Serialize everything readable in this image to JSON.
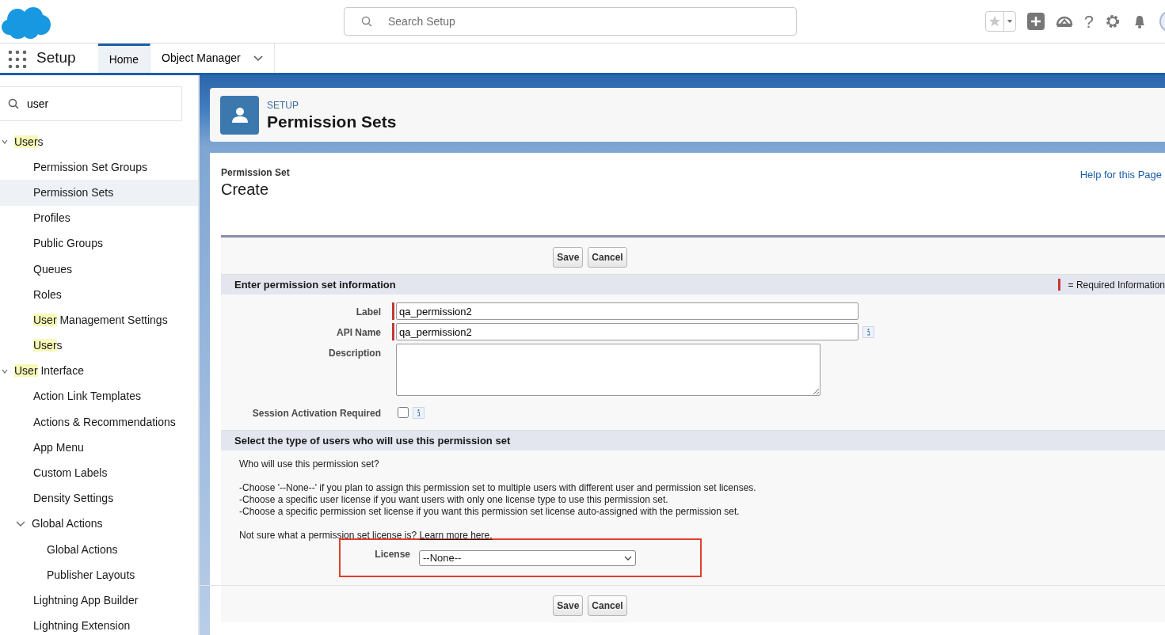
{
  "header": {
    "search": {
      "placeholder": "Search Setup"
    },
    "help_glyph": "?"
  },
  "app_nav": {
    "title": "Setup",
    "tabs": [
      {
        "label": "Home",
        "selected": true,
        "dropdown": false
      },
      {
        "label": "Object Manager",
        "selected": false,
        "dropdown": true
      }
    ]
  },
  "sidebar": {
    "search": {
      "value": "user"
    },
    "items": [
      {
        "match": "User",
        "rest": "s",
        "expanded": true,
        "selected": false,
        "children": [
          {
            "rest": "Permission Set Groups",
            "selected": false
          },
          {
            "rest": "Permission Sets",
            "selected": true
          },
          {
            "rest": "Profiles",
            "selected": false
          },
          {
            "rest": "Public Groups",
            "selected": false
          },
          {
            "rest": "Queues",
            "selected": false
          },
          {
            "rest": "Roles",
            "selected": false
          },
          {
            "match": "User",
            "rest": " Management Settings",
            "selected": false
          },
          {
            "match": "User",
            "rest": "s",
            "selected": false
          }
        ]
      },
      {
        "match": "User",
        "rest": " Interface",
        "expanded": true,
        "selected": false,
        "children": [
          {
            "rest": "Action Link Templates",
            "selected": false
          },
          {
            "rest": "Actions & Recommendations",
            "selected": false
          },
          {
            "rest": "App Menu",
            "selected": false
          },
          {
            "rest": "Custom Labels",
            "selected": false
          },
          {
            "rest": "Density Settings",
            "selected": false
          },
          {
            "rest": "Global Actions",
            "expanded": true,
            "selected": false,
            "children": [
              {
                "rest": "Global Actions",
                "selected": false
              },
              {
                "rest": "Publisher Layouts",
                "selected": false
              }
            ]
          },
          {
            "rest": "Lightning App Builder",
            "selected": false
          },
          {
            "rest": "Lightning Extension",
            "selected": false
          }
        ]
      }
    ]
  },
  "page_header": {
    "eyebrow": "SETUP",
    "title": "Permission Sets"
  },
  "form": {
    "subtitle": "Permission Set",
    "title": "Create",
    "help_link": "Help for this Page",
    "buttons": [
      "Save",
      "Cancel"
    ],
    "section_1": {
      "title": "Enter permission set information",
      "required_legend": "= Required Information",
      "fields": [
        {
          "kind": "text",
          "label": "Label",
          "value": "qa_permission2",
          "required": true,
          "info": false
        },
        {
          "kind": "text",
          "label": "API Name",
          "value": "qa_permission2",
          "required": true,
          "info": true
        },
        {
          "kind": "textarea",
          "label": "Description",
          "required": false,
          "info": false
        },
        {
          "kind": "checkbox",
          "label": "Session Activation Required",
          "checked": false,
          "required": false,
          "info": true
        }
      ]
    },
    "section_2": {
      "title": "Select the type of users who will use this permission set",
      "question": "Who will use this permission set?",
      "lines": [
        "-Choose '--None--' if you plan to assign this permission set to multiple users with different user and permission set licenses.",
        "-Choose a specific user license if you want users with only one license type to use this permission set.",
        "-Choose a specific permission set license if you want this permission set license auto-assigned with the permission set."
      ],
      "learn_text": "Not sure what a permission set license is?",
      "learn_link": "Learn more here.",
      "license": {
        "label": "License",
        "value": "--None--",
        "highlighted": true
      }
    },
    "bottom_buttons": [
      "Save",
      "Cancel"
    ]
  }
}
